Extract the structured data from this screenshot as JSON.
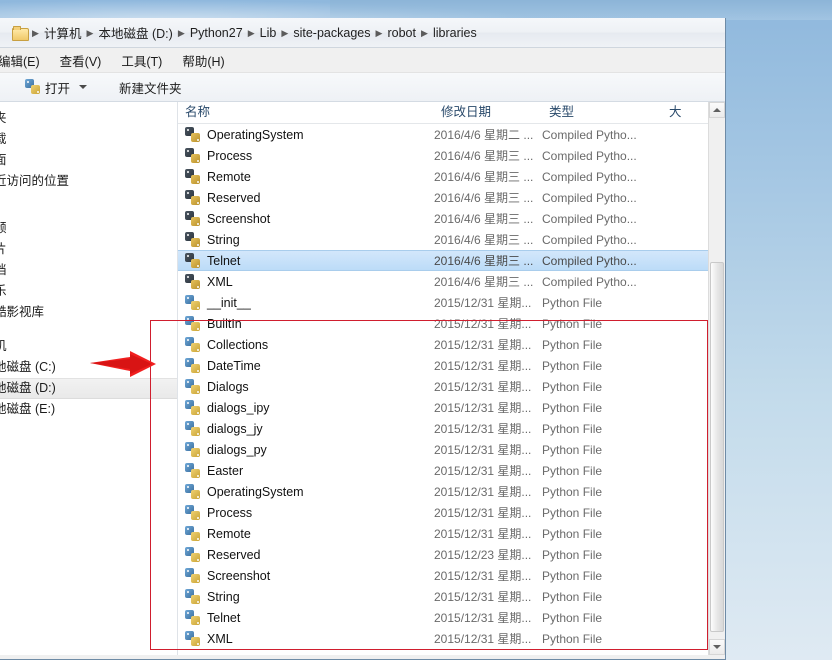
{
  "window": {
    "title": "libraries",
    "address": {
      "folder_icon": "folder-icon",
      "crumbs": [
        "计算机",
        "本地磁盘 (D:)",
        "Python27",
        "Lib",
        "site-packages",
        "robot",
        "libraries"
      ],
      "separator": "▶"
    },
    "menubar": [
      "编辑(E)",
      "查看(V)",
      "工具(T)",
      "帮助(H)"
    ],
    "commandbar": {
      "open_label": "打开",
      "open_icon": "python-file-icon",
      "dropdown_icon": "chevron-down-icon",
      "new_folder_label": "新建文件夹"
    }
  },
  "navpane": {
    "groups": [
      {
        "items": [
          "夹",
          "载",
          "面",
          "近访问的位置"
        ]
      },
      {
        "items": [
          "频",
          "片",
          "档",
          "乐",
          "酷影视库"
        ]
      },
      {
        "items": [
          "机",
          "地磁盘 (C:)",
          "地磁盘 (D:)",
          "地磁盘 (E:)"
        ]
      },
      {
        "items": [
          ""
        ]
      }
    ],
    "selected": "地磁盘 (D:)"
  },
  "filelist": {
    "columns": [
      "名称",
      "修改日期",
      "类型",
      "大"
    ],
    "sort_indicator": "sort-ascending-icon",
    "selected_row": "Telnet",
    "rows": [
      {
        "name": "OperatingSystem",
        "date": "2016/4/6 星期二 ...",
        "type": "Compiled Pytho...",
        "icon": "pyc"
      },
      {
        "name": "Process",
        "date": "2016/4/6 星期三 ...",
        "type": "Compiled Pytho...",
        "icon": "pyc"
      },
      {
        "name": "Remote",
        "date": "2016/4/6 星期三 ...",
        "type": "Compiled Pytho...",
        "icon": "pyc"
      },
      {
        "name": "Reserved",
        "date": "2016/4/6 星期三 ...",
        "type": "Compiled Pytho...",
        "icon": "pyc"
      },
      {
        "name": "Screenshot",
        "date": "2016/4/6 星期三 ...",
        "type": "Compiled Pytho...",
        "icon": "pyc"
      },
      {
        "name": "String",
        "date": "2016/4/6 星期三 ...",
        "type": "Compiled Pytho...",
        "icon": "pyc"
      },
      {
        "name": "Telnet",
        "date": "2016/4/6 星期三 ...",
        "type": "Compiled Pytho...",
        "icon": "pyc",
        "selected": true
      },
      {
        "name": "XML",
        "date": "2016/4/6 星期三 ...",
        "type": "Compiled Pytho...",
        "icon": "pyc"
      },
      {
        "name": "__init__",
        "date": "2015/12/31 星期...",
        "type": "Python File",
        "icon": "py"
      },
      {
        "name": "BuiltIn",
        "date": "2015/12/31 星期...",
        "type": "Python File",
        "icon": "py"
      },
      {
        "name": "Collections",
        "date": "2015/12/31 星期...",
        "type": "Python File",
        "icon": "py"
      },
      {
        "name": "DateTime",
        "date": "2015/12/31 星期...",
        "type": "Python File",
        "icon": "py"
      },
      {
        "name": "Dialogs",
        "date": "2015/12/31 星期...",
        "type": "Python File",
        "icon": "py"
      },
      {
        "name": "dialogs_ipy",
        "date": "2015/12/31 星期...",
        "type": "Python File",
        "icon": "py"
      },
      {
        "name": "dialogs_jy",
        "date": "2015/12/31 星期...",
        "type": "Python File",
        "icon": "py"
      },
      {
        "name": "dialogs_py",
        "date": "2015/12/31 星期...",
        "type": "Python File",
        "icon": "py"
      },
      {
        "name": "Easter",
        "date": "2015/12/31 星期...",
        "type": "Python File",
        "icon": "py"
      },
      {
        "name": "OperatingSystem",
        "date": "2015/12/31 星期...",
        "type": "Python File",
        "icon": "py"
      },
      {
        "name": "Process",
        "date": "2015/12/31 星期...",
        "type": "Python File",
        "icon": "py"
      },
      {
        "name": "Remote",
        "date": "2015/12/31 星期...",
        "type": "Python File",
        "icon": "py"
      },
      {
        "name": "Reserved",
        "date": "2015/12/23 星期...",
        "type": "Python File",
        "icon": "py"
      },
      {
        "name": "Screenshot",
        "date": "2015/12/31 星期...",
        "type": "Python File",
        "icon": "py"
      },
      {
        "name": "String",
        "date": "2015/12/31 星期...",
        "type": "Python File",
        "icon": "py"
      },
      {
        "name": "Telnet",
        "date": "2015/12/31 星期...",
        "type": "Python File",
        "icon": "py"
      },
      {
        "name": "XML",
        "date": "2015/12/31 星期...",
        "type": "Python File",
        "icon": "py"
      }
    ]
  },
  "scrollbar": {
    "up_icon": "scroll-up-arrow-icon",
    "down_icon": "scroll-down-arrow-icon"
  },
  "annotations": {
    "color": "#d01e2e",
    "rect_label": "highlight-rectangle",
    "arrow_label": "pointer-arrow"
  }
}
